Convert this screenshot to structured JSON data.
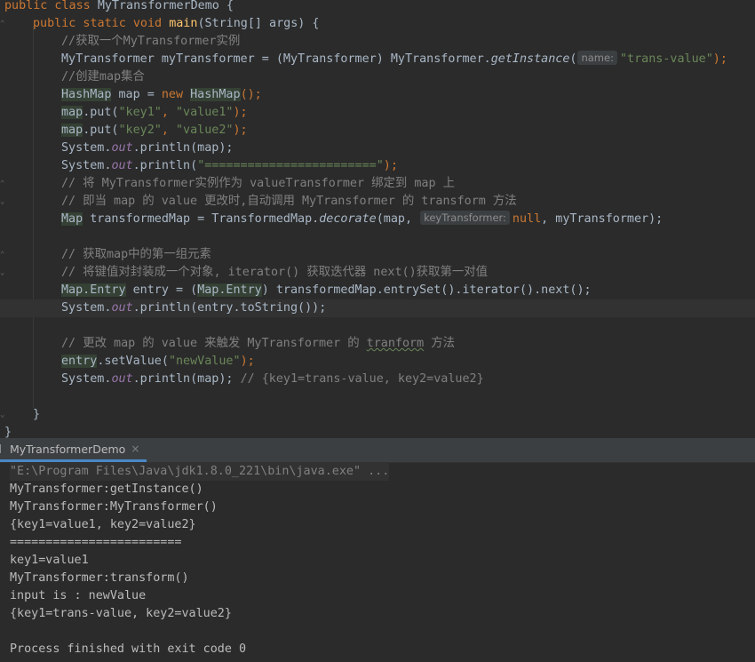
{
  "editor": {
    "lines": [
      {
        "class_decl": "public class ",
        "class_name": "MyTransformerDemo",
        "brace": " {"
      },
      {
        "method_decl": "public static void ",
        "method_name": "main",
        "params": "(String[] args) {"
      },
      {
        "comment": "//获取一个MyTransformer实例"
      },
      {
        "text_a": "MyTransformer myTransformer = (MyTransformer) MyTransformer.",
        "call": "getInstance",
        "paren": "(",
        "hint": "name:",
        "arg": "\"trans-value\"",
        "end": ");"
      },
      {
        "comment": "//创建map集合"
      },
      {
        "type": "HashMap",
        "mid": " map = ",
        "kw": "new",
        "space": " ",
        "type2": "HashMap",
        "end": "();"
      },
      {
        "obj": "map",
        "call": ".put(",
        "s1": "\"key1\"",
        "comma": ", ",
        "s2": "\"value1\"",
        "end": ");"
      },
      {
        "obj": "map",
        "call": ".put(",
        "s1": "\"key2\"",
        "comma": ", ",
        "s2": "\"value2\"",
        "end": ");"
      },
      {
        "pre": "System.",
        "field": "out",
        "post": ".println(map);"
      },
      {
        "pre": "System.",
        "field": "out",
        "post": ".println(",
        "str": "\"========================\"",
        "end": ");"
      },
      {
        "comment": "// 将 MyTransformer实例作为 valueTransformer 绑定到 map 上"
      },
      {
        "comment": "// 即当 map 的 value 更改时,自动调用 MyTransformer 的 transform 方法"
      },
      {
        "type": "Map",
        "mid": " transformedMap = TransformedMap.",
        "call": "decorate",
        "args": "(map, ",
        "hint": "keyTransformer:",
        "kw": "null",
        "end": ", myTransformer);"
      },
      {
        "empty": ""
      },
      {
        "comment": "// 获取map中的第一组元素"
      },
      {
        "comment": "// 将键值对封装成一个对象, iterator() 获取迭代器 next()获取第一对值"
      },
      {
        "type": "Map.Entry",
        "mid": " entry = (",
        "type2": "Map.Entry",
        "end": ") transformedMap.entrySet().iterator().next();"
      },
      {
        "pre": "System.",
        "field": "out",
        "post": ".println(entry.toString());"
      },
      {
        "empty": ""
      },
      {
        "comment_a": "// 更改 map 的 value 来触发 MyTransformer 的 ",
        "comment_wavy": "tranform",
        "comment_b": " 方法"
      },
      {
        "obj": "entry",
        "call": ".setValue(",
        "s1": "\"newValue\"",
        "end": ");"
      },
      {
        "pre": "System.",
        "field": "out",
        "post": ".println(map); ",
        "comment": "// {key1=trans-value, key2=value2}"
      },
      {
        "empty": ""
      },
      {
        "brace": "}"
      },
      {
        "brace": "}"
      }
    ]
  },
  "run_panel": {
    "tab_label": "MyTransformerDemo",
    "tab_close": "×",
    "output": [
      "\"E:\\Program Files\\Java\\jdk1.8.0_221\\bin\\java.exe\" ...",
      "MyTransformer:getInstance()",
      "MyTransformer:MyTransformer()",
      "{key1=value1, key2=value2}",
      "========================",
      "key1=value1",
      "MyTransformer:transform()",
      "input is : newValue",
      "{key1=trans-value, key2=value2}",
      "",
      "Process finished with exit code 0"
    ]
  },
  "colors": {
    "background": "#2b2b2b",
    "keyword": "#cc7832",
    "string": "#6a8759",
    "comment": "#808080",
    "method": "#ffc66d",
    "static_field": "#9876aa",
    "tab_underline": "#4a88c7"
  }
}
